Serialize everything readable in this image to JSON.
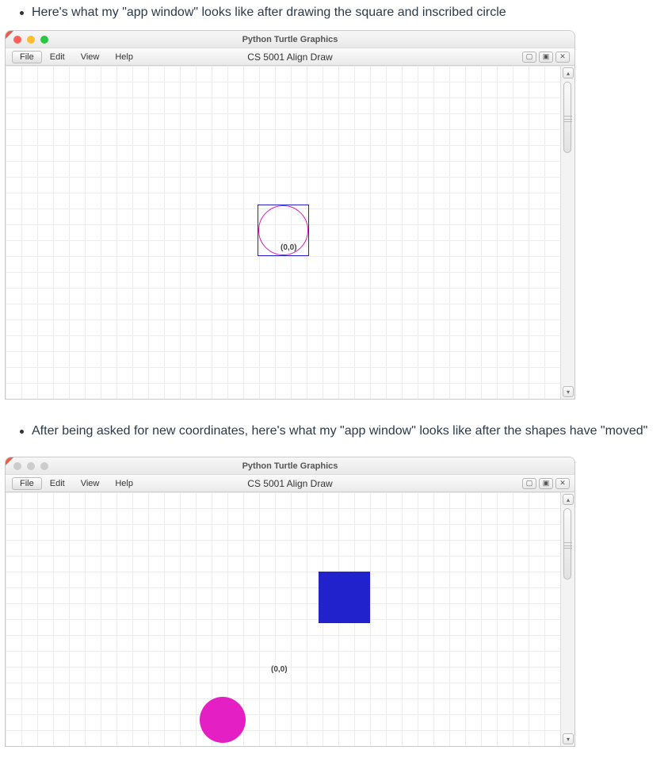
{
  "bullet1": "Here's what my \"app window\" looks like after drawing the square and inscribed circle",
  "bullet2": "After being asked for new coordinates, here's what my \"app window\" looks like after the shapes have \"moved\"",
  "window": {
    "title": "Python Turtle Graphics",
    "subtitle": "CS 5001 Align Draw",
    "menu": {
      "file": "File",
      "edit": "Edit",
      "view": "View",
      "help": "Help"
    },
    "origin_label": "(0,0)"
  },
  "win_ctrl": {
    "min": "▢",
    "max": "▣",
    "close": "✕"
  },
  "scroll": {
    "up": "▴",
    "down": "▾"
  }
}
